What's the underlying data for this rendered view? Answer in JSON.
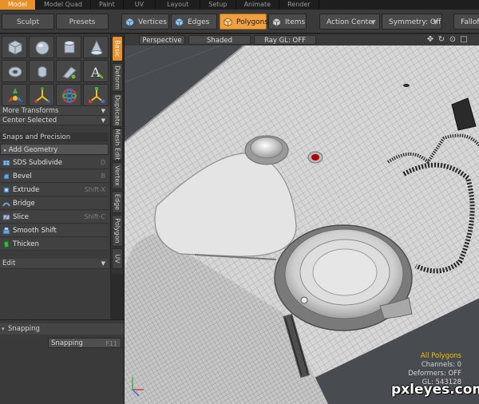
{
  "top_tabs": [
    "Model",
    "Model Quad",
    "Paint",
    "UV",
    "Layout",
    "Setup",
    "Animate",
    "Render"
  ],
  "active_top_tab": 0,
  "left_buttons": {
    "sculpt": "Sculpt",
    "presets": "Presets"
  },
  "toolbar": {
    "vertices": "Vertices",
    "edges": "Edges",
    "polygons": "Polygons",
    "items": "Items",
    "action_center": "Action Center",
    "symmetry": "Symmetry: Off",
    "falloff": "Falloff"
  },
  "left_panel": {
    "more_transforms": "More Transforms",
    "center_selected": "Center Selected",
    "snaps_precision": "Snaps and Precision",
    "add_geometry": "Add Geometry",
    "tools": [
      {
        "label": "SDS Subdivide",
        "shortcut": "D"
      },
      {
        "label": "Bevel",
        "shortcut": "B"
      },
      {
        "label": "Extrude",
        "shortcut": "Shift-X"
      },
      {
        "label": "Bridge",
        "shortcut": ""
      },
      {
        "label": "Slice",
        "shortcut": "Shift-C"
      },
      {
        "label": "Smooth Shift",
        "shortcut": ""
      },
      {
        "label": "Thicken",
        "shortcut": ""
      }
    ],
    "edit": "Edit"
  },
  "vertical_tabs": [
    "Basic",
    "Deform",
    "Duplicate",
    "Mesh Edit",
    "Vertex",
    "Edge",
    "Polygon",
    "UV"
  ],
  "active_vertical_tab": 0,
  "snapping": {
    "header": "Snapping",
    "button": "Snapping",
    "shortcut": "F11"
  },
  "viewport": {
    "perspective": "Perspective",
    "shaded": "Shaded",
    "raygl": "Ray GL: OFF",
    "stats": {
      "selection": "All Polygons",
      "channels": "Channels: 0",
      "deformers": "Deformers: OFF",
      "gl": "GL: 543128"
    }
  },
  "watermark": "pxleyes.com",
  "colors": {
    "accent": "#e8902a",
    "highlight": "#f2c200",
    "panel": "#3c3c3c"
  }
}
